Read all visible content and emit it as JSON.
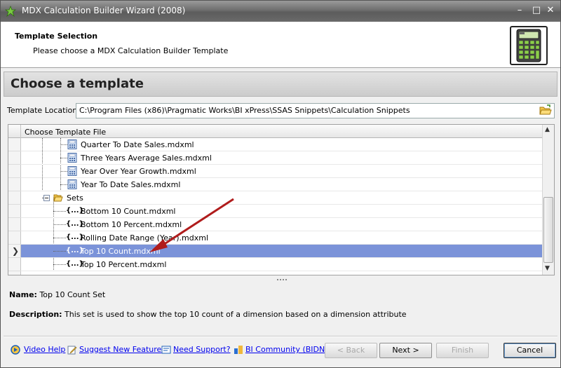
{
  "window": {
    "title": "MDX Calculation Builder Wizard (2008)"
  },
  "header": {
    "title": "Template Selection",
    "subtitle": "Please choose a MDX Calculation Builder Template"
  },
  "section": {
    "title": "Choose a template"
  },
  "location": {
    "label": "Template Location:",
    "value": "C:\\Program Files (x86)\\Pragmatic Works\\BI xPress\\SSAS Snippets\\Calculation Snippets"
  },
  "grid": {
    "column_header": "Choose Template File",
    "rows": [
      {
        "label": "Quarter To Date Sales.mdxml",
        "type": "calc"
      },
      {
        "label": "Three Years Average Sales.mdxml",
        "type": "calc"
      },
      {
        "label": "Year Over Year Growth.mdxml",
        "type": "calc"
      },
      {
        "label": "Year To Date Sales.mdxml",
        "type": "calc"
      },
      {
        "label": "Sets",
        "type": "folder"
      },
      {
        "label": "Bottom 10 Count.mdxml",
        "type": "set"
      },
      {
        "label": "Bottom 10 Percent.mdxml",
        "type": "set"
      },
      {
        "label": "Rolling Date Range (Year).mdxml",
        "type": "set"
      },
      {
        "label": "Top 10 Count.mdxml",
        "type": "set",
        "selected": true
      },
      {
        "label": "Top 10 Percent.mdxml",
        "type": "set"
      }
    ],
    "set_glyph": "{...}"
  },
  "info": {
    "name_label": "Name:",
    "name_value": "Top 10 Count Set",
    "desc_label": "Description:",
    "desc_value": "This set is used to show the top 10 count of a dimension based on a dimension attribute"
  },
  "footer": {
    "links": [
      "Video Help",
      "Suggest New Feature",
      "Need Support?",
      "BI Community (BIDN)"
    ],
    "back": "< Back",
    "next": "Next >",
    "finish": "Finish",
    "cancel": "Cancel"
  },
  "colors": {
    "selection": "#7b93d9",
    "annotation_arrow": "#b01c1c",
    "link": "#0000ee"
  }
}
